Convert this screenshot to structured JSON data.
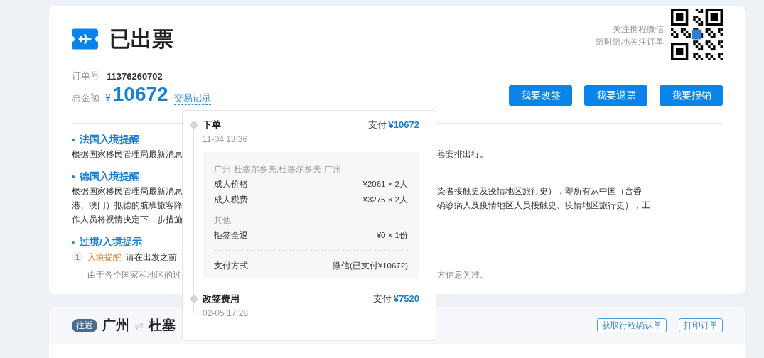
{
  "header": {
    "status": "已出票",
    "order_label": "订单号",
    "order_no": "11376260702",
    "total_label": "总金额",
    "currency": "¥",
    "total": "10672",
    "record_link": "交易记录"
  },
  "follow": {
    "lines": [
      "关注携程微信",
      "随时随地关注订单"
    ]
  },
  "buttons": [
    "我要改签",
    "我要退票",
    "我要报销"
  ],
  "notices": [
    {
      "kind": "paragraph",
      "title": "法国入境提醒",
      "lines": [
        {
          "left": "根据国家移民管理局最新消息",
          "right": "善安排出行。"
        }
      ]
    },
    {
      "kind": "paragraph",
      "title": "德国入境提醒",
      "lines": [
        {
          "left": "根据国家移民管理局最新消息",
          "right": "染者接触史及疫情地区旅行史），即所有从中国（含香"
        },
        {
          "left": "港、澳门）抵德的航班旅客降",
          "right": "确诊病人及疫情地区人员接触史、疫情地区旅行史），工"
        },
        {
          "left": "作人员将视情决定下一步措施"
        }
      ]
    },
    {
      "kind": "steps",
      "title": "过境/入境提示",
      "steps": [
        {
          "number": "1",
          "tag": "入境提醒",
          "text": "请在出发之前"
        }
      ],
      "note": {
        "left": "由于各个国家和地区的过",
        "right": "方信息为准。"
      }
    }
  ],
  "popover": {
    "entries": [
      {
        "title": "下单",
        "time": "11-04 13:36",
        "pay_label": "支付",
        "pay_amount": "¥10672",
        "details": {
          "route": "广州-杜塞尔多夫,杜塞尔多夫-广州",
          "rows": [
            {
              "label": "成人价格",
              "value": "¥2061 × 2人"
            },
            {
              "label": "成人税费",
              "value": "¥3275 × 2人"
            }
          ],
          "other_label": "其他",
          "other_rows": [
            {
              "label": "拒签全退",
              "value": "¥0 × 1份"
            }
          ],
          "payment": {
            "label": "支付方式",
            "value": "微信(已支付¥10672)"
          }
        }
      },
      {
        "title": "改签费用",
        "time": "02-05 17:28",
        "pay_label": "支付",
        "pay_amount": "¥7520"
      }
    ]
  },
  "trip": {
    "badge": "往返",
    "from": "广州",
    "arrow": "⇌",
    "to": "杜塞",
    "buttons": [
      "获取行程确认单",
      "打印订单"
    ]
  }
}
